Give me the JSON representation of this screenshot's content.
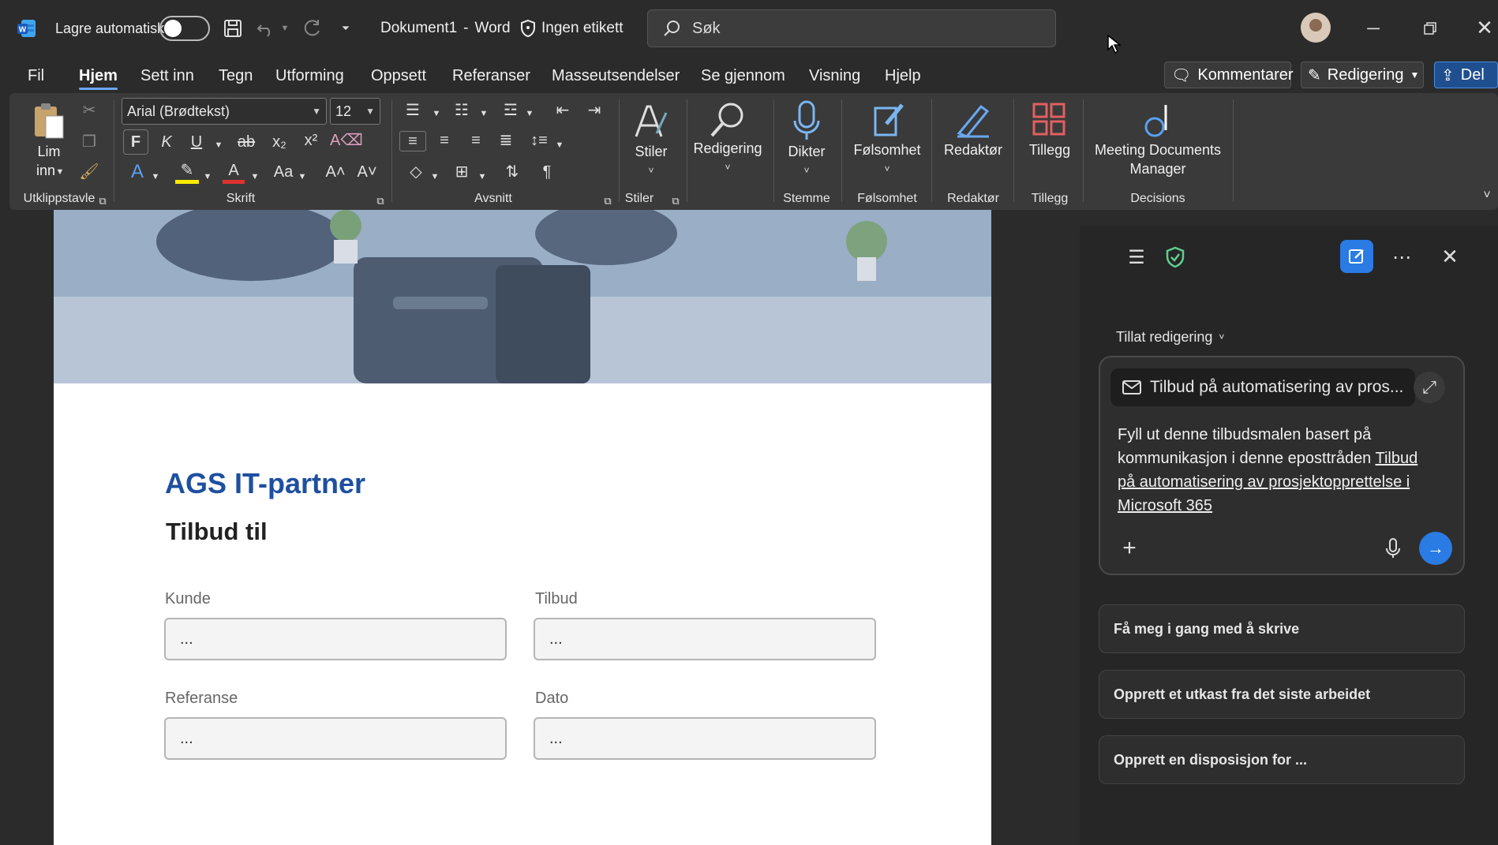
{
  "titlebar": {
    "app_icon": "word-icon",
    "autosave_label": "Lagre automatisk",
    "autosave_on": false,
    "doc_name": "Dokument1",
    "separator": "-",
    "app_name": "Word",
    "sensitivity_label": "Ingen etikett",
    "search_placeholder": "Søk"
  },
  "tabs": [
    "Fil",
    "Hjem",
    "Sett inn",
    "Tegn",
    "Utforming",
    "Oppsett",
    "Referanser",
    "Masseutsendelser",
    "Se gjennom",
    "Visning",
    "Hjelp"
  ],
  "active_tab": "Hjem",
  "right_buttons": {
    "comments": "Kommentarer",
    "editing": "Redigering",
    "share": "Del"
  },
  "ribbon": {
    "clipboard": {
      "paste": "Lim",
      "paste2": "inn",
      "label": "Utklippstavle"
    },
    "font": {
      "family": "Arial (Brødtekst)",
      "size": "12",
      "bold": "F",
      "italic": "K",
      "underline": "U",
      "label": "Skrift"
    },
    "paragraph": {
      "label": "Avsnitt"
    },
    "styles": {
      "button": "Stiler",
      "label": "Stiler"
    },
    "editing": {
      "button": "Redigering"
    },
    "voice": {
      "button": "Dikter",
      "label": "Stemme"
    },
    "sensitivity": {
      "button": "Følsomhet",
      "label": "Følsomhet"
    },
    "editor": {
      "button": "Redaktør",
      "label": "Redaktør"
    },
    "addins": {
      "button": "Tillegg",
      "label": "Tillegg"
    },
    "decisions": {
      "button1": "Meeting Documents",
      "button2": "Manager",
      "label": "Decisions"
    }
  },
  "document": {
    "title": "AGS IT-partner",
    "subtitle": "Tilbud til",
    "fields": [
      {
        "label": "Kunde",
        "value": "..."
      },
      {
        "label": "Tilbud",
        "value": "..."
      },
      {
        "label": "Referanse",
        "value": "..."
      },
      {
        "label": "Dato",
        "value": "..."
      }
    ]
  },
  "copilot": {
    "permission": "Tillat redigering",
    "attachment": "Tilbud på automatisering av pros...",
    "prompt_text": "Fyll ut denne tilbudsmalen basert på kommunikasjon i denne eposttråden",
    "prompt_link": "Tilbud på automatisering av prosjektopprettelse i Microsoft 365",
    "suggestions": [
      "Få meg i gang med å skrive",
      "Opprett et utkast fra det siste arbeidet",
      "Opprett en disposisjon for ..."
    ]
  },
  "colors": {
    "accent": "#1e4fa0",
    "send": "#2a7be4",
    "pane_bg": "#262626"
  }
}
